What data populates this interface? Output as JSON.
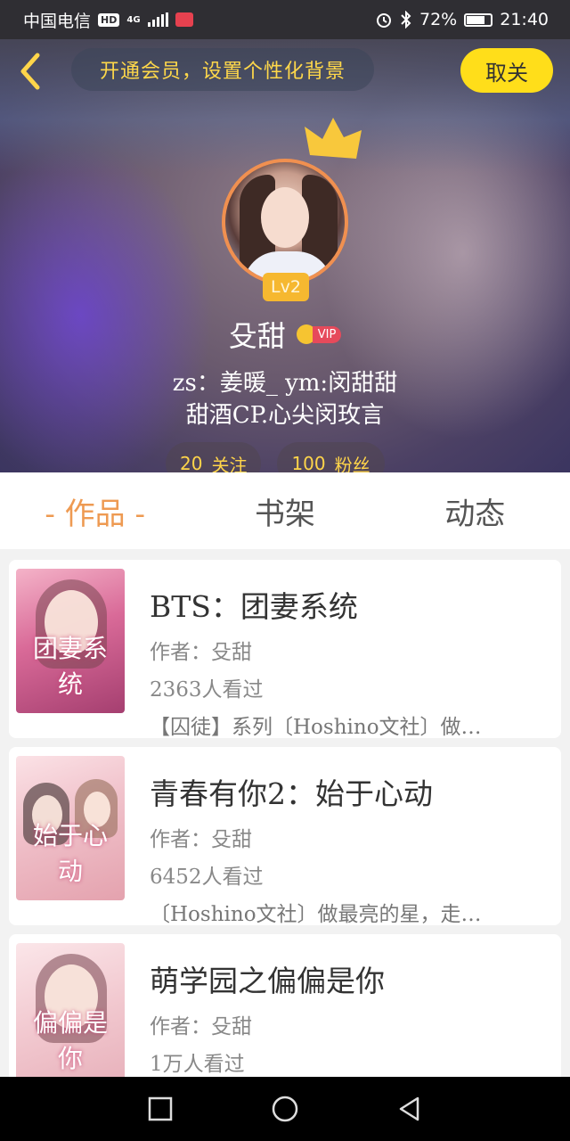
{
  "status_bar": {
    "carrier": "中国电信",
    "hd": "HD",
    "net_type": "4G",
    "battery_pct": "72%",
    "time": "21:40"
  },
  "header": {
    "vip_banner": "开通会员，设置个性化背景",
    "cancel_label": "取关"
  },
  "profile": {
    "level": "Lv2",
    "username": "殳甜",
    "vip_label": "VIP",
    "bio_line1": "zs：姜暖_ ym:闵甜甜",
    "bio_line2": "甜酒CP.心尖闵玫言",
    "following_count": "20",
    "following_label": "关注",
    "fans_count": "100",
    "fans_label": "粉丝"
  },
  "tabs": [
    {
      "label": "- 作品 -",
      "active": true
    },
    {
      "label": "书架",
      "active": false
    },
    {
      "label": "动态",
      "active": false
    }
  ],
  "works": [
    {
      "title": "BTS：团妻系统",
      "author": "作者：殳甜",
      "views": "2363人看过",
      "desc": "【囚徒】系列〔Hoshino文社〕做…",
      "cover_text": "团妻系统"
    },
    {
      "title": "青春有你2：始于心动",
      "author": "作者：殳甜",
      "views": "6452人看过",
      "desc": "〔Hoshino文社〕做最亮的星，走…",
      "cover_text": "始于心动"
    },
    {
      "title": "萌学园之偏偏是你",
      "author": "作者：殳甜",
      "views": "1万人看过",
      "desc": "",
      "cover_text": "偏偏是你"
    }
  ],
  "colors": {
    "accent_orange": "#ee9a52",
    "banner_yellow": "#ffd84a",
    "cancel_bg": "#ffde1a"
  }
}
